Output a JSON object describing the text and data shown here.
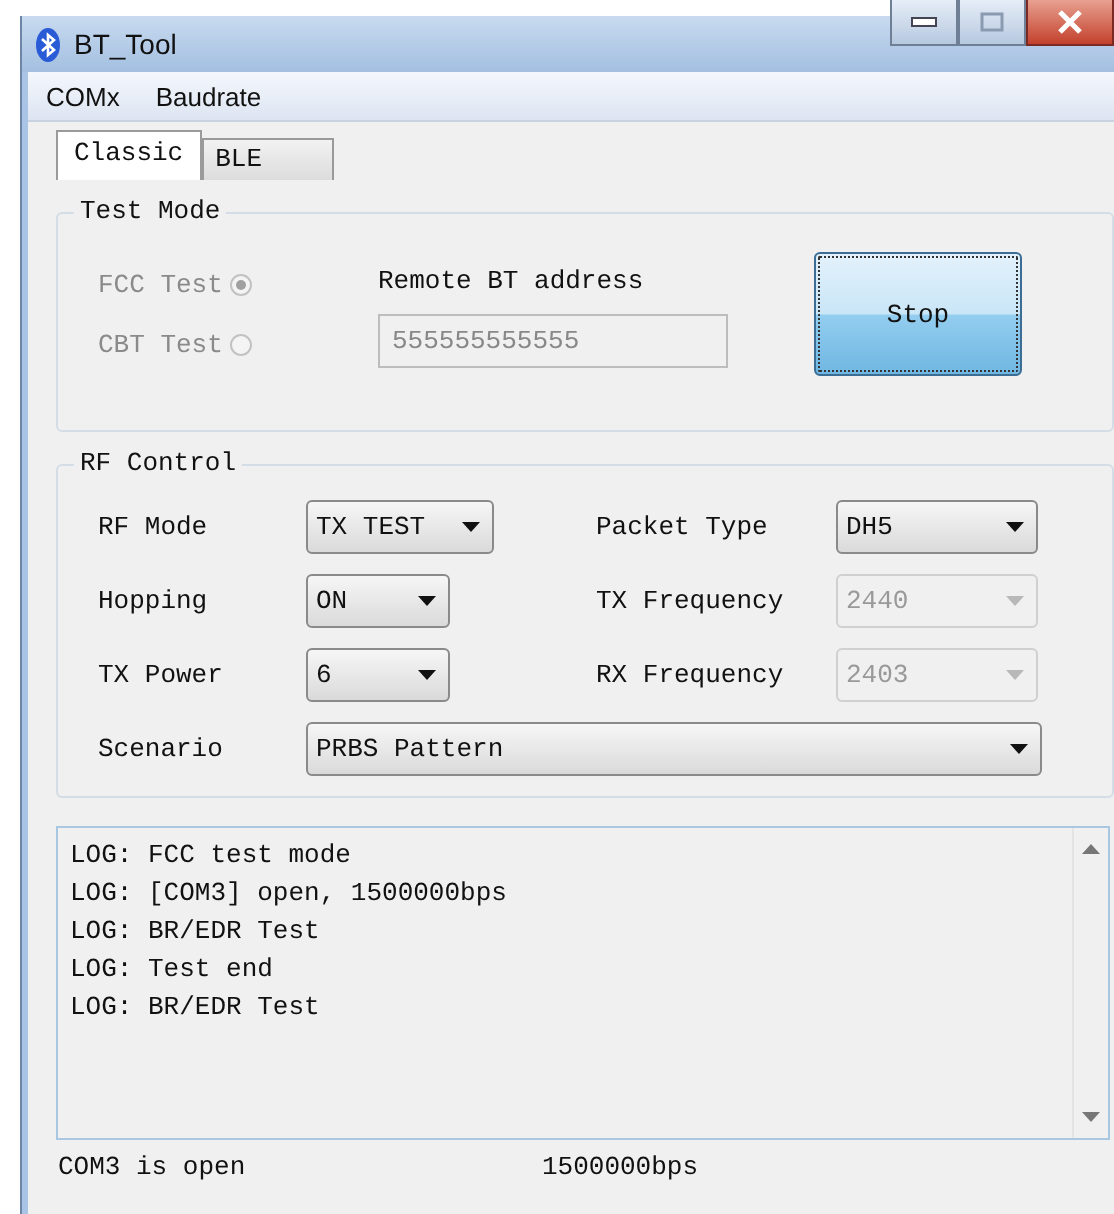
{
  "window": {
    "title": "BT_Tool"
  },
  "menu": [
    "COMx",
    "Baudrate"
  ],
  "tabs": [
    {
      "label": "Classic",
      "selected": true
    },
    {
      "label": "BLE",
      "selected": false
    }
  ],
  "test_mode": {
    "title": "Test Mode",
    "options": [
      {
        "label": "FCC Test",
        "selected": true,
        "disabled": true
      },
      {
        "label": "CBT Test",
        "selected": false,
        "disabled": true
      }
    ],
    "address_label": "Remote BT address",
    "address": {
      "value": "555555555555",
      "disabled": true
    },
    "button": "Stop"
  },
  "rf_control": {
    "title": "RF Control",
    "left": [
      {
        "label": "RF Mode",
        "value": "TX TEST",
        "disabled": false
      },
      {
        "label": "Hopping",
        "value": "ON",
        "disabled": false
      },
      {
        "label": "TX Power",
        "value": "6",
        "disabled": false
      }
    ],
    "right": [
      {
        "label": "Packet Type",
        "value": "DH5",
        "disabled": false
      },
      {
        "label": "TX Frequency",
        "value": "2440",
        "disabled": true
      },
      {
        "label": "RX Frequency",
        "value": "2403",
        "disabled": true
      }
    ],
    "scenario": {
      "label": "Scenario",
      "value": "PRBS Pattern",
      "disabled": false
    }
  },
  "log": [
    "LOG: FCC test mode",
    "LOG: [COM3] open, 1500000bps",
    "LOG: BR/EDR Test",
    "LOG: Test end",
    "LOG: BR/EDR Test"
  ],
  "status_bar": [
    "COM3 is open",
    "1500000bps"
  ]
}
